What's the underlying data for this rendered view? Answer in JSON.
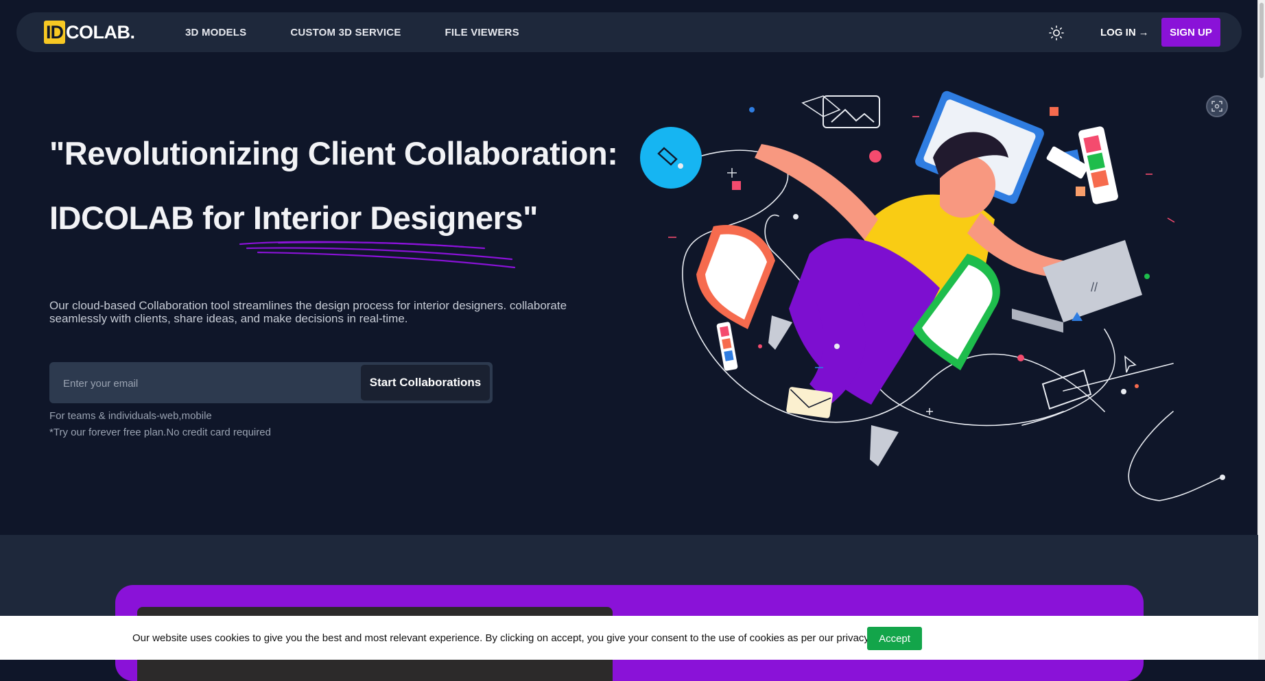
{
  "brand": {
    "logo_mark": "ID",
    "logo_text": "COLAB."
  },
  "nav": {
    "links": [
      "3D MODELS",
      "CUSTOM 3D SERVICE",
      "FILE VIEWERS"
    ],
    "theme_icon": "sun-icon",
    "login_label": "LOG IN",
    "login_arrow": "→",
    "signup_label": "SIGN UP"
  },
  "hero": {
    "title_line1": "\"Revolutionizing Client Collaboration:",
    "title_line2": "IDCOLAB for Interior Designers\"",
    "description": "Our cloud-based Collaboration tool streamlines the design process for interior designers. collaborate seamlessly with clients, share ideas, and make decisions in real-time.",
    "email_placeholder": "Enter your email",
    "cta_label": "Start Collaborations",
    "note1": "For teams & individuals-web,mobile",
    "note2": "*Try our forever free plan.No credit card required"
  },
  "cookie": {
    "text": "Our website uses cookies to give you the best and most relevant experience. By clicking on accept, you give your consent to the use of cookies as per our privacy policy.",
    "accept_label": "Accept"
  },
  "colors": {
    "background": "#0f1629",
    "nav_bg": "#1e283b",
    "accent_purple": "#8a12d8",
    "logo_yellow": "#f7c823",
    "accept_green": "#13a54a"
  }
}
